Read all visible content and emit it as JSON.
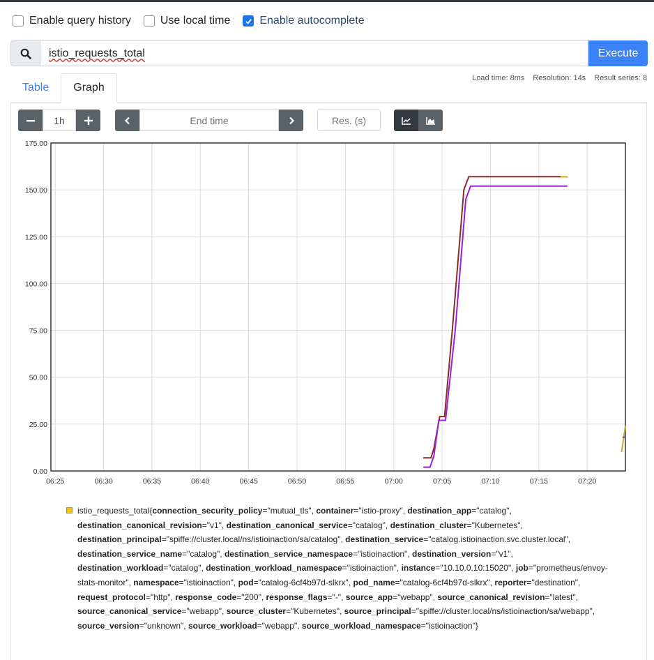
{
  "options": {
    "query_history": {
      "label": "Enable query history",
      "checked": false
    },
    "local_time": {
      "label": "Use local time",
      "checked": false
    },
    "autocomplete": {
      "label": "Enable autocomplete",
      "checked": true
    }
  },
  "search": {
    "icon": "search-icon",
    "expression": "istio_requests_total",
    "execute_label": "Execute"
  },
  "stats": {
    "load_time": "Load time: 8ms",
    "resolution": "Resolution: 14s",
    "result_series": "Result series: 8"
  },
  "tabs": [
    {
      "label": "Table",
      "active": false
    },
    {
      "label": "Graph",
      "active": true
    }
  ],
  "controls": {
    "range_minus": "−",
    "range_value": "1h",
    "range_plus": "+",
    "end_time_placeholder": "End time",
    "resolution_placeholder": "Res. (s)",
    "prev_icon": "chevron-left-icon",
    "next_icon": "chevron-right-icon",
    "line_mode_icon": "line-chart-icon",
    "stacked_mode_icon": "area-chart-icon"
  },
  "chart_data": {
    "type": "line",
    "ylim": [
      0,
      175
    ],
    "yticks": [
      "0.00",
      "25.00",
      "50.00",
      "75.00",
      "100.00",
      "125.00",
      "150.00",
      "175.00"
    ],
    "xticks": [
      "06:25",
      "06:30",
      "06:35",
      "06:40",
      "06:45",
      "06:50",
      "06:55",
      "07:00",
      "07:05",
      "07:10",
      "07:15",
      "07:20"
    ],
    "xlim_minutes": [
      0,
      59.4
    ],
    "grid": true,
    "series": [
      {
        "color": "#8b2a2a",
        "x": [
          38.5,
          39.3,
          39.6,
          40.2,
          40.7,
          41.5,
          42.7,
          43.2,
          53.4
        ],
        "y": [
          7,
          7,
          12,
          29,
          29,
          75,
          150,
          157,
          157
        ]
      },
      {
        "color": "#9b1fd6",
        "x": [
          38.5,
          39.2,
          39.6,
          40.1,
          40.8,
          41.8,
          42.9,
          43.4,
          53.4
        ],
        "y": [
          2,
          2,
          8,
          27,
          27,
          75,
          145,
          152,
          152
        ]
      },
      {
        "color": "#f0c419",
        "x": [
          52.7,
          53.4
        ],
        "y": [
          157,
          157
        ]
      },
      {
        "color": "#c2b030",
        "x": [
          59.0,
          59.4
        ],
        "y": [
          10,
          24
        ]
      },
      {
        "color": "#4f5cc9",
        "x": [
          59.1,
          59.4
        ],
        "y": [
          18,
          18
        ]
      }
    ]
  },
  "legend": {
    "swatch_color": "#f0c419",
    "metric": "istio_requests_total",
    "labels": [
      {
        "k": "connection_security_policy",
        "v": "mutual_tls"
      },
      {
        "k": "container",
        "v": "istio-proxy"
      },
      {
        "k": "destination_app",
        "v": "catalog"
      },
      {
        "k": "destination_canonical_revision",
        "v": "v1"
      },
      {
        "k": "destination_canonical_service",
        "v": "catalog"
      },
      {
        "k": "destination_cluster",
        "v": "Kubernetes"
      },
      {
        "k": "destination_principal",
        "v": "spiffe://cluster.local/ns/istioinaction/sa/catalog"
      },
      {
        "k": "destination_service",
        "v": "catalog.istioinaction.svc.cluster.local"
      },
      {
        "k": "destination_service_name",
        "v": "catalog"
      },
      {
        "k": "destination_service_namespace",
        "v": "istioinaction"
      },
      {
        "k": "destination_version",
        "v": "v1"
      },
      {
        "k": "destination_workload",
        "v": "catalog"
      },
      {
        "k": "destination_workload_namespace",
        "v": "istioinaction"
      },
      {
        "k": "instance",
        "v": "10.10.0.10:15020"
      },
      {
        "k": "job",
        "v": "prometheus/envoy-stats-monitor"
      },
      {
        "k": "namespace",
        "v": "istioinaction"
      },
      {
        "k": "pod",
        "v": "catalog-6cf4b97d-slkrx"
      },
      {
        "k": "pod_name",
        "v": "catalog-6cf4b97d-slkrx"
      },
      {
        "k": "reporter",
        "v": "destination"
      },
      {
        "k": "request_protocol",
        "v": "http"
      },
      {
        "k": "response_code",
        "v": "200"
      },
      {
        "k": "response_flags",
        "v": "-"
      },
      {
        "k": "source_app",
        "v": "webapp"
      },
      {
        "k": "source_canonical_revision",
        "v": "latest"
      },
      {
        "k": "source_canonical_service",
        "v": "webapp"
      },
      {
        "k": "source_cluster",
        "v": "Kubernetes"
      },
      {
        "k": "source_principal",
        "v": "spiffe://cluster.local/ns/istioinaction/sa/webapp"
      },
      {
        "k": "source_version",
        "v": "unknown"
      },
      {
        "k": "source_workload",
        "v": "webapp"
      },
      {
        "k": "source_workload_namespace",
        "v": "istioinaction"
      }
    ]
  }
}
